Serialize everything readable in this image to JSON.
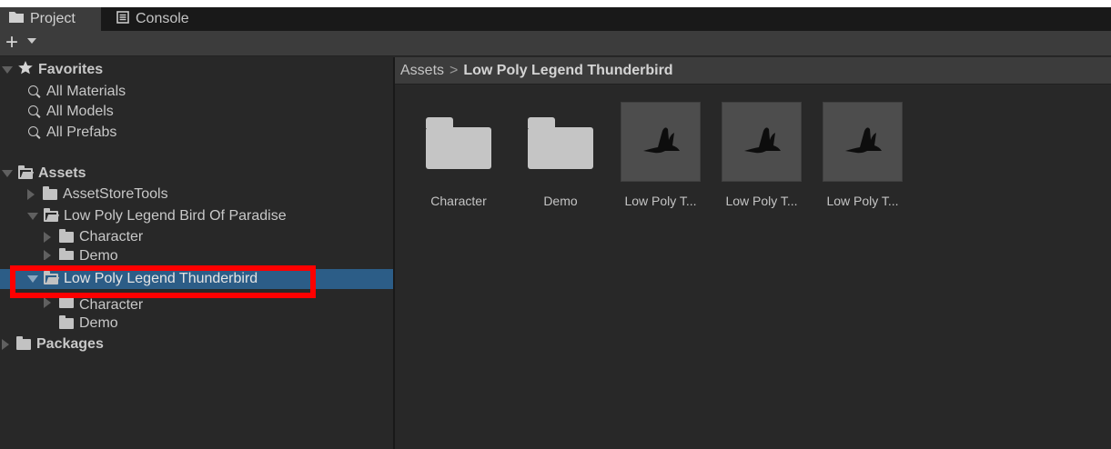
{
  "tabs": [
    {
      "label": "Project",
      "icon": "folder-icon",
      "active": true
    },
    {
      "label": "Console",
      "icon": "console-icon",
      "active": false
    }
  ],
  "toolbar": {
    "create_label": "+",
    "create_icon": "plus-icon"
  },
  "tree": {
    "favorites": {
      "label": "Favorites",
      "icon": "star-icon",
      "items": [
        "All Materials",
        "All Models",
        "All Prefabs"
      ]
    },
    "assets_label": "Assets",
    "asset_items": [
      {
        "label": "AssetStoreTools"
      },
      {
        "label": "Low Poly Legend Bird Of Paradise"
      },
      {
        "label": "Character"
      },
      {
        "label": "Demo"
      },
      {
        "label": "Low Poly Legend Thunderbird",
        "selected": true
      },
      {
        "label": "Character"
      },
      {
        "label": "Demo"
      }
    ],
    "packages_label": "Packages"
  },
  "breadcrumb": {
    "root": "Assets",
    "separator": ">",
    "current": "Low Poly Legend Thunderbird"
  },
  "assets": [
    {
      "caption": "Character",
      "kind": "folder"
    },
    {
      "caption": "Demo",
      "kind": "folder"
    },
    {
      "caption": "Low Poly T...",
      "kind": "prefab"
    },
    {
      "caption": "Low Poly T...",
      "kind": "prefab"
    },
    {
      "caption": "Low Poly T...",
      "kind": "prefab"
    }
  ],
  "colors": {
    "selection": "#2c5d87",
    "highlight": "#ff0000",
    "panel": "#282828",
    "toolbar": "#3c3c3c"
  }
}
